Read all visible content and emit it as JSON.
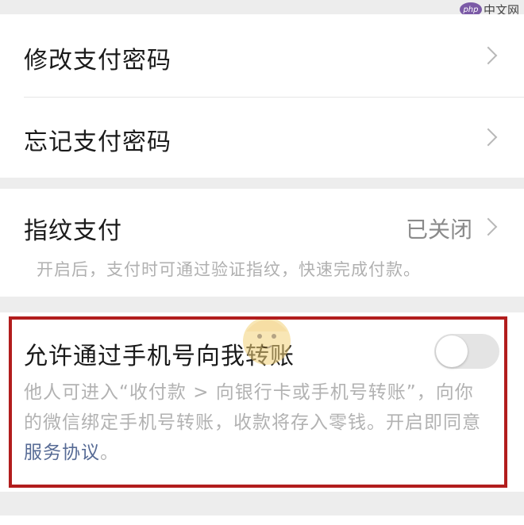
{
  "settings": {
    "change_password": "修改支付密码",
    "forgot_password": "忘记支付密码",
    "fingerprint": {
      "label": "指纹支付",
      "status": "已关闭",
      "hint": "开启后，支付时可通过验证指纹，快速完成付款。"
    },
    "phone_transfer": {
      "label": "允许通过手机号向我转账",
      "enabled": false,
      "description": "他人可进入“收付款 > 向银行卡或手机号转账”，向你的微信绑定手机号转账，收款将存入零钱。开启即同意",
      "link": "服务协议",
      "suffix": "。"
    }
  },
  "watermark": {
    "logo": "php",
    "text": "中文网"
  },
  "colors": {
    "link": "#576b95",
    "highlight_border": "#b21d1d",
    "background": "#ededed"
  },
  "icons": {
    "row_arrow": "chevron-right-icon",
    "toggle": "switch-off"
  }
}
